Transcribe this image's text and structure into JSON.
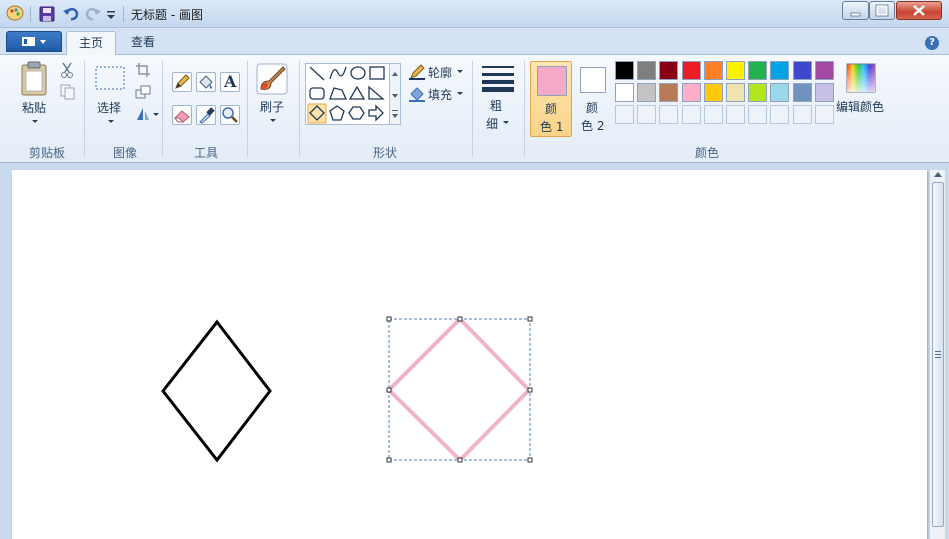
{
  "window": {
    "title": "无标题 - 画图"
  },
  "tabs": [
    {
      "label": "主页",
      "active": true
    },
    {
      "label": "查看",
      "active": false
    }
  ],
  "groups": {
    "clipboard": {
      "label": "剪贴板",
      "paste": "粘贴"
    },
    "image": {
      "label": "图像",
      "select": "选择"
    },
    "tools": {
      "label": "工具",
      "text_glyph": "A"
    },
    "brushes": {
      "label": "刷子"
    },
    "shapes": {
      "label": "形状",
      "outline": "轮廓",
      "fill": "填充"
    },
    "size": {
      "label_line1": "粗",
      "label_line2": "细"
    },
    "colors": {
      "label": "颜色",
      "color1_line1": "颜",
      "color1_line2": "色 1",
      "color2_line1": "颜",
      "color2_line2": "色 2",
      "edit_colors": "编辑颜色",
      "color1_value": "#f4a9c6",
      "color2_value": "#ffffff",
      "palette_row1": [
        "#000000",
        "#7f7f7f",
        "#880015",
        "#ed1c24",
        "#ff7f27",
        "#fff200",
        "#22b14c",
        "#00a2e8",
        "#3f48cc",
        "#a349a4"
      ],
      "palette_row2": [
        "#ffffff",
        "#c3c3c3",
        "#b97a57",
        "#ffaec9",
        "#ffc90e",
        "#efe4b0",
        "#b5e61d",
        "#99d9ea",
        "#7092be",
        "#c8bfe7"
      ]
    }
  },
  "canvas": {
    "shapes": [
      {
        "kind": "diamond",
        "stroke": "#000000",
        "selected": false
      },
      {
        "kind": "diamond",
        "stroke": "#f0b3cb",
        "selected": true
      }
    ]
  }
}
